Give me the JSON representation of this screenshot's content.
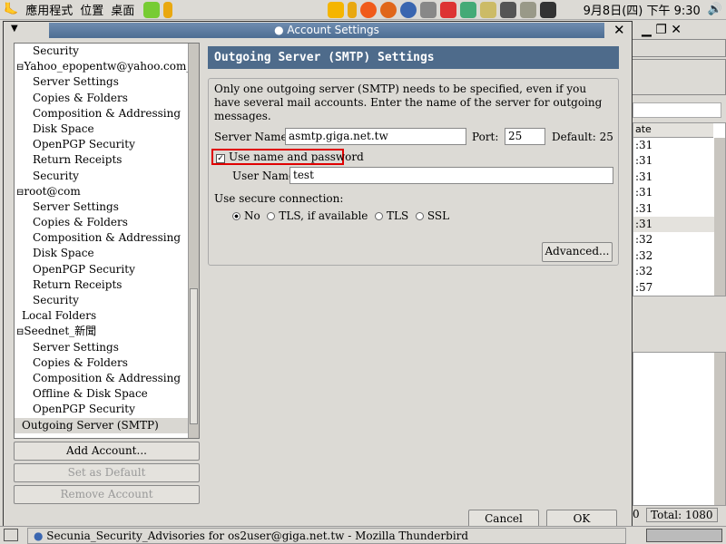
{
  "topbar": {
    "menus": [
      "應用程式",
      "位置",
      "桌面"
    ],
    "clock": "9月8日(四) 下午 9:30"
  },
  "dialog": {
    "title": "Account Settings"
  },
  "tree": [
    {
      "label": "Security",
      "level": 1
    },
    {
      "label": "Yahoo_epopentw@yahoo.com_信...",
      "level": 0
    },
    {
      "label": "Server Settings",
      "level": 1
    },
    {
      "label": "Copies & Folders",
      "level": 1
    },
    {
      "label": "Composition & Addressing",
      "level": 1
    },
    {
      "label": "Disk Space",
      "level": 1
    },
    {
      "label": "OpenPGP Security",
      "level": 1
    },
    {
      "label": "Return Receipts",
      "level": 1
    },
    {
      "label": "Security",
      "level": 1
    },
    {
      "label": "root@com",
      "level": 0
    },
    {
      "label": "Server Settings",
      "level": 1
    },
    {
      "label": "Copies & Folders",
      "level": 1
    },
    {
      "label": "Composition & Addressing",
      "level": 1
    },
    {
      "label": "Disk Space",
      "level": 1
    },
    {
      "label": "OpenPGP Security",
      "level": 1
    },
    {
      "label": "Return Receipts",
      "level": 1
    },
    {
      "label": "Security",
      "level": 1
    },
    {
      "label": "Local Folders",
      "level": 0
    },
    {
      "label": "Seednet_新聞",
      "level": 0
    },
    {
      "label": "Server Settings",
      "level": 1
    },
    {
      "label": "Copies & Folders",
      "level": 1
    },
    {
      "label": "Composition & Addressing",
      "level": 1
    },
    {
      "label": "Offline & Disk Space",
      "level": 1
    },
    {
      "label": "OpenPGP Security",
      "level": 1
    },
    {
      "label": "Outgoing Server (SMTP)",
      "level": 0,
      "selected": true
    }
  ],
  "buttons": {
    "add": "Add Account...",
    "default": "Set as Default",
    "remove": "Remove Account",
    "cancel": "Cancel",
    "ok": "OK",
    "advanced": "Advanced..."
  },
  "smtp": {
    "header": "Outgoing Server (SMTP) Settings",
    "description": "Only one outgoing server (SMTP) needs to be specified, even if you have several mail accounts. Enter the name of the server for outgoing messages.",
    "server_label": "Server Name:",
    "server_value": "asmtp.giga.net.tw",
    "port_label": "Port:",
    "port_value": "25",
    "default_label": "Default:",
    "default_value": "25",
    "use_auth_label": "Use name and password",
    "use_auth_checked": true,
    "user_label": "User Name:",
    "user_value": "test",
    "secure_label": "Use secure connection:",
    "secure_options": [
      "No",
      "TLS, if available",
      "TLS",
      "SSL"
    ],
    "secure_selected": "No"
  },
  "bg_app": {
    "col_header": "ate",
    "times": [
      ":31",
      ":31",
      ":31",
      ":31",
      ":31",
      ":31",
      ":32",
      ":32",
      ":32",
      ":57"
    ],
    "total": "Total: 1080",
    "unread_partial": "0"
  },
  "taskbar": {
    "window": "Secunia_Security_Advisories for os2user@giga.net.tw - Mozilla Thunderbird"
  },
  "colors": {
    "highlight": "#e00000",
    "header": "#4e6b8b"
  }
}
